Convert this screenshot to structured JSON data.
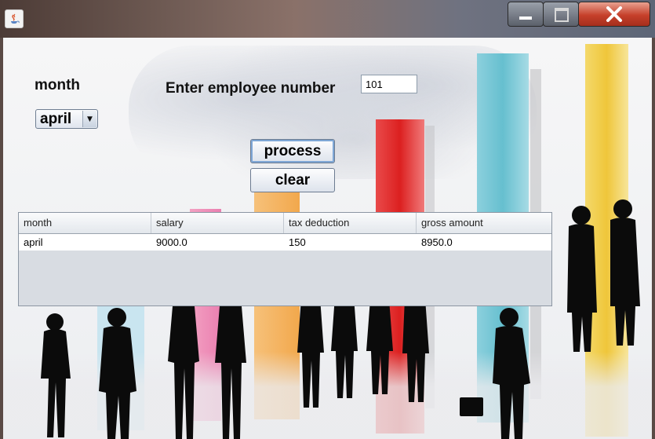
{
  "window": {
    "title": "",
    "controls": [
      "minimize-icon",
      "maximize-icon",
      "close-icon"
    ]
  },
  "form": {
    "month_label": "month",
    "month_selected": "april",
    "employee_label": "Enter employee number",
    "employee_number": "101",
    "process_label": "process",
    "clear_label": "clear"
  },
  "table": {
    "columns": [
      "month",
      "salary",
      "tax deduction",
      "gross amount"
    ],
    "rows": [
      [
        "april",
        "9000.0",
        "150",
        "8950.0"
      ]
    ]
  },
  "colors": {
    "close_button": "#c6402b",
    "accent_focus": "#7fa7d6"
  }
}
